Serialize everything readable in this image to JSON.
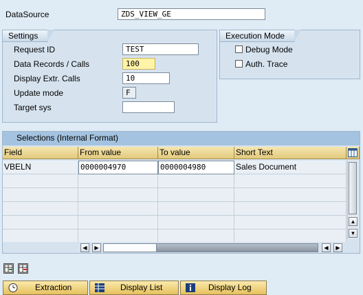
{
  "datasource": {
    "label": "DataSource",
    "value": "ZDS_VIEW_GE"
  },
  "settings": {
    "title": "Settings",
    "request_id": {
      "label": "Request ID",
      "value": "TEST"
    },
    "data_records": {
      "label": "Data Records / Calls",
      "value": "100"
    },
    "display_extr": {
      "label": "Display Extr. Calls",
      "value": "10"
    },
    "update_mode": {
      "label": "Update mode",
      "value": "F"
    },
    "target_sys": {
      "label": "Target sys",
      "value": ""
    }
  },
  "execution_mode": {
    "title": "Execution Mode",
    "debug_mode": {
      "label": "Debug Mode",
      "checked": false
    },
    "auth_trace": {
      "label": "Auth. Trace",
      "checked": false
    }
  },
  "selections": {
    "title": "Selections (Internal Format)",
    "columns": [
      "Field",
      "From value",
      "To value",
      "Short Text"
    ],
    "rows": [
      {
        "field": "VBELN",
        "from": "0000004970",
        "to": "0000004980",
        "text": "Sales Document"
      }
    ]
  },
  "buttons": {
    "extraction": "Extraction",
    "display_list": "Display List",
    "display_log": "Display Log"
  },
  "colors": {
    "background": "#dfebf5",
    "button": "#f0d178",
    "required_field": "#fff4a8"
  }
}
